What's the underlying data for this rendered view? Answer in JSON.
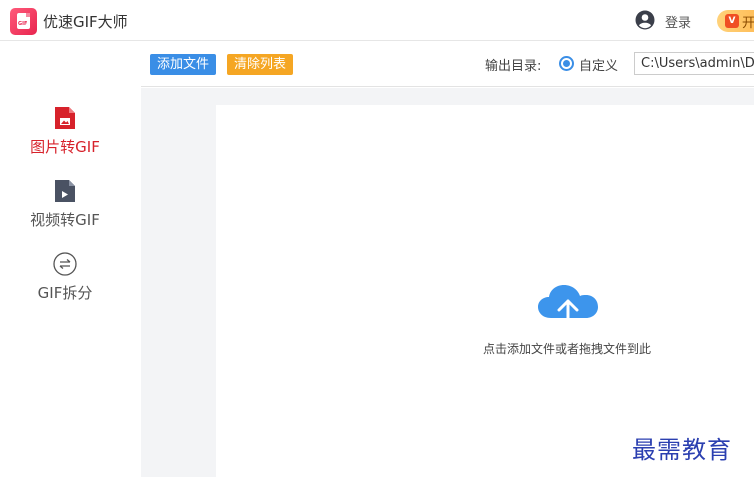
{
  "app": {
    "title": "优速GIF大师",
    "logo_text": "GIF",
    "login_label": "登录",
    "vip_label": "开",
    "vip_icon_text": "V"
  },
  "sidebar": {
    "items": [
      {
        "label": "图片转GIF",
        "icon": "image-file-icon",
        "active": true
      },
      {
        "label": "视频转GIF",
        "icon": "video-file-icon",
        "active": false
      },
      {
        "label": "GIF拆分",
        "icon": "split-icon",
        "active": false
      }
    ]
  },
  "toolbar": {
    "add_label": "添加文件",
    "clear_label": "清除列表",
    "output_label": "输出目录:",
    "radio_label": "自定义",
    "path_value": "C:\\Users\\admin\\De"
  },
  "dropzone": {
    "hint": "点击添加文件或者拖拽文件到此"
  },
  "watermark": "最需教育",
  "colors": {
    "accent": "#3a8ee6",
    "clear_button": "#f5a623",
    "active_nav": "#d7222b",
    "cloud": "#3d95ec"
  }
}
